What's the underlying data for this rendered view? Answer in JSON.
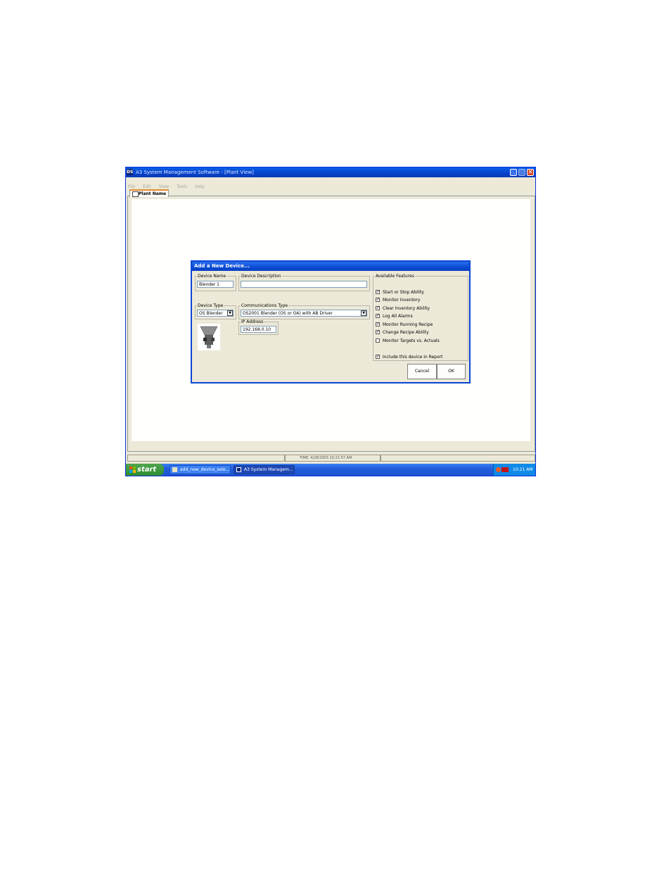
{
  "window": {
    "title": "A3 System Management Software - [Plant View]",
    "app_icon_text": "DS",
    "close_symbol": "✕"
  },
  "menu": [
    "File",
    "Edit",
    "View",
    "Tools",
    "Help"
  ],
  "tab": {
    "label": "Plant Name"
  },
  "status": {
    "time_text": "TIME:  4/28/2003 10:21:57 AM"
  },
  "dialog": {
    "title": "Add a New Device...",
    "device_name_label": "Device Name",
    "device_name_value": "Blender 1",
    "device_description_label": "Device Description",
    "device_description_value": "",
    "device_type_label": "Device Type",
    "device_type_value": "OS Blender",
    "communications_type_label": "Communications Type",
    "communications_type_value": "OS2001 Blender (OS or OA) with AB Driver",
    "ip_address_label": "IP Address",
    "ip_address_value": "192.168.0.10",
    "features_label": "Available Features",
    "features": [
      {
        "label": "Start or Stop Ability",
        "checked": true
      },
      {
        "label": "Monitor Inventory",
        "checked": true
      },
      {
        "label": "Clear Inventory Ability",
        "checked": true
      },
      {
        "label": "Log All Alarms",
        "checked": true
      },
      {
        "label": "Monitor Running Recipe",
        "checked": true
      },
      {
        "label": "Change Recipe Ability",
        "checked": true
      },
      {
        "label": "Monitor Targets vs. Actuals",
        "checked": false
      }
    ],
    "include_report_label": "Include this device in Report",
    "include_report_checked": true,
    "cancel_label": "Cancel",
    "ok_label": "OK",
    "dropdown_arrow": "▼",
    "check_mark": "✓"
  },
  "taskbar": {
    "start_label": "start",
    "tasks": [
      "add_new_device_sele...",
      "A3 System Managem..."
    ],
    "clock": "10:21 AM"
  }
}
